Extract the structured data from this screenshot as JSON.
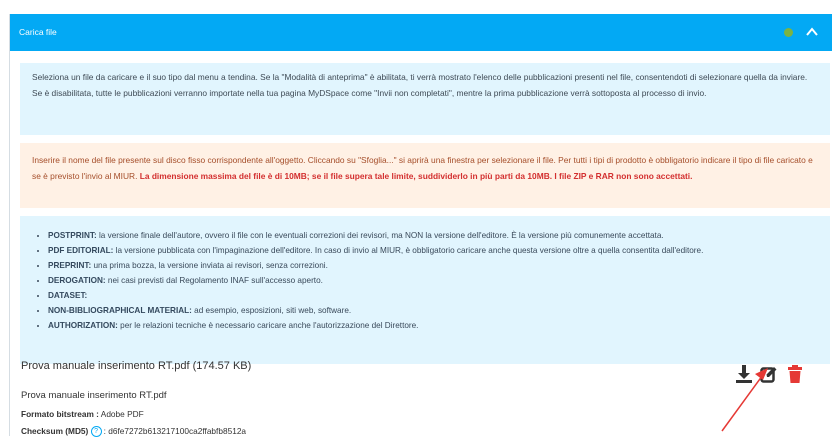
{
  "header": {
    "title": "Carica file",
    "status_color": "#7cb342",
    "toggle_icon": "chevron-up-icon"
  },
  "info_blue": {
    "text": "Seleziona un file da caricare e il suo tipo dal menu a tendina. Se la \"Modalità di anteprima\" è abilitata, ti verrà mostrato l'elenco delle pubblicazioni presenti nel file, consentendoti di selezionare quella da inviare. Se è disabilitata, tutte le pubblicazioni verranno importate nella tua pagina MyDSpace come \"Invii non completati\", mentre la prima pubblicazione verrà sottoposta al processo di invio."
  },
  "info_orange": {
    "text": "Inserire il nome del file presente sul disco fisso corrispondente all'oggetto. Cliccando su \"Sfoglia...\" si aprirà una finestra per selezionare il file. Per tutti i tipi di prodotto è obbligatorio indicare il tipo di file caricato e se è previsto l'invio al MIUR. ",
    "warning": "La dimensione massima del file è di 10MB; se il file supera tale limite, suddividerlo in più parti da 10MB. I file ZIP e RAR non sono accettati."
  },
  "types": [
    {
      "name": "POSTPRINT:",
      "desc": " la versione finale dell'autore, ovvero il file con le eventuali correzioni dei revisori, ma NON la versione dell'editore. È la versione più comunemente accettata."
    },
    {
      "name": "PDF EDITORIAL:",
      "desc": " la versione pubblicata con l'impaginazione dell'editore. In caso di invio al MIUR, è obbligatorio caricare anche questa versione oltre a quella consentita dall'editore."
    },
    {
      "name": "PREPRINT:",
      "desc": " una prima bozza, la versione inviata ai revisori, senza correzioni."
    },
    {
      "name": "DEROGATION:",
      "desc": " nei casi previsti dal Regolamento INAF sull'accesso aperto."
    },
    {
      "name": "DATASET:",
      "desc": ""
    },
    {
      "name": "NON-BIBLIOGRAPHICAL MATERIAL:",
      "desc": " ad esempio, esposizioni, siti web, software."
    },
    {
      "name": "AUTHORIZATION:",
      "desc": " per le relazioni tecniche è necessario caricare anche l'autorizzazione del Direttore."
    }
  ],
  "file": {
    "title": "Prova manuale inserimento RT.pdf (174.57 KB)",
    "name": "Prova manuale inserimento RT.pdf",
    "format_label": "Formato bitstream :",
    "format_value": "Adobe PDF",
    "checksum_label": "Checksum (MD5)",
    "checksum_value": ": d6fe7272b613217100ca2ffabfb8512a"
  },
  "actions": {
    "download_icon": "download-icon",
    "edit_icon": "edit-icon",
    "delete_icon": "trash-icon",
    "delete_color": "#e53935",
    "arrow_color": "#e53935"
  }
}
